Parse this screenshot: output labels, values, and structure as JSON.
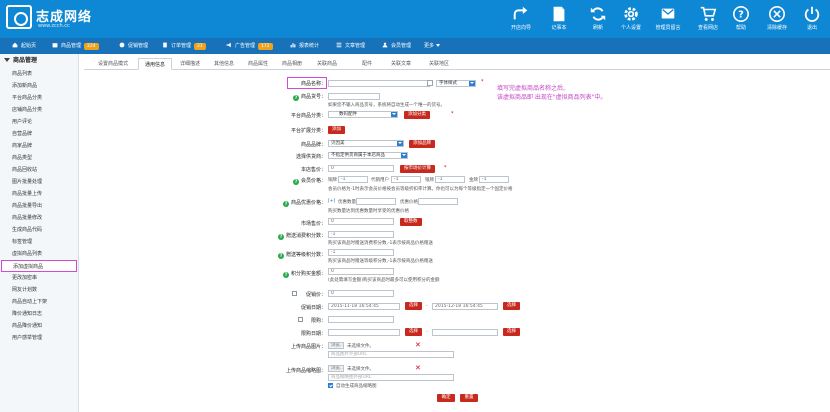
{
  "brand": {
    "name": "志成网络",
    "url": "www.zcch.cc"
  },
  "header_buttons": [
    {
      "label": "开店向导",
      "icon": "share-icon"
    },
    {
      "label": "记事本",
      "icon": "notepad-icon"
    },
    {
      "label": "刷新",
      "icon": "refresh-icon"
    },
    {
      "label": "个人设置",
      "icon": "gear-icon"
    },
    {
      "label": "管理员留言",
      "icon": "message-icon"
    },
    {
      "label": "查看网店",
      "icon": "cart-icon"
    },
    {
      "label": "帮助",
      "icon": "help-icon"
    },
    {
      "label": "清除缓存",
      "icon": "clear-icon"
    },
    {
      "label": "退出",
      "icon": "power-icon"
    }
  ],
  "nav": {
    "items": [
      {
        "label": "起始页",
        "badge": ""
      },
      {
        "label": "商品管理",
        "badge": "224"
      },
      {
        "label": "促销管理",
        "badge": ""
      },
      {
        "label": "订单管理",
        "badge": "21"
      },
      {
        "label": "广告管理",
        "badge": "172"
      },
      {
        "label": "报表统计",
        "badge": ""
      },
      {
        "label": "文章管理",
        "badge": ""
      },
      {
        "label": "会员管理",
        "badge": ""
      },
      {
        "label": "更多",
        "badge": ""
      }
    ]
  },
  "sidebar": {
    "title": "商品管理",
    "items": [
      {
        "label": "商品列表"
      },
      {
        "label": "添加新商品"
      },
      {
        "label": "平台商品分类"
      },
      {
        "label": "店铺商品分类"
      },
      {
        "label": "用户评论"
      },
      {
        "label": "自营品牌"
      },
      {
        "label": "商家品牌"
      },
      {
        "label": "商品类型"
      },
      {
        "label": "商品回收站"
      },
      {
        "label": "图片批量处理"
      },
      {
        "label": "商品批量上传"
      },
      {
        "label": "商品批量导出"
      },
      {
        "label": "商品批量修改"
      },
      {
        "label": "生成商品代码"
      },
      {
        "label": "标签管理"
      },
      {
        "label": "虚拟商品列表"
      },
      {
        "label": "添加虚拟商品"
      },
      {
        "label": "更改加密串"
      },
      {
        "label": "网友计划数"
      },
      {
        "label": "商品自动上下架"
      },
      {
        "label": "降价通知日志"
      },
      {
        "label": "商品降价通知"
      },
      {
        "label": "用户感举管理"
      }
    ]
  },
  "tabs": [
    "设置商品模式",
    "通用信息",
    "详细描述",
    "其他信息",
    "商品属性",
    "商品相册",
    "关联商品",
    "配件",
    "关联文章",
    "关联地区"
  ],
  "form": {
    "goods_name_label": "商品名称：",
    "font_style": "字体样式",
    "goods_sn_label": "商品货号：",
    "goods_sn_hint": "如果您不输入商品货号，系统将自动生成一个唯一的货号。",
    "category_label": "平台商品分类：",
    "category_value": "数码配件",
    "add_category": "添加分类",
    "ext_category_label": "平台扩展分类：",
    "add": "添加",
    "brand_label": "商品品牌：",
    "brand_value": "贝因美",
    "add_brand": "添加品牌",
    "supplier_label": "选择供货商：",
    "supplier_value": "不指定供货商属于本店商品",
    "shop_price_label": "本店售价：",
    "shop_price_value": "0",
    "calc_market_price": "按市场价计算",
    "member_price_label": "会员价格：",
    "member_levels": [
      {
        "name": "铜牌",
        "value": "-1"
      },
      {
        "name": "代销用户",
        "value": "-1"
      },
      {
        "name": "银牌",
        "value": "-1"
      },
      {
        "name": "金牌",
        "value": "-1"
      }
    ],
    "member_price_hint": "会员价格为-1时表示会员价格按会员等级折扣率计算。你也可以为每个等级指定一个固定价格",
    "volume_price_label": "商品优惠价格：",
    "volume_add": "[+]",
    "volume_qty_label": "优惠数量",
    "volume_price_label2": "优惠价格",
    "volume_hint": "购买数量达到优惠数量时享受的优惠价格",
    "market_price_label": "市场售价：",
    "market_price_value": "0",
    "round_price": "取整数",
    "give_points_label": "赠送消费积分数：",
    "give_points_value": "-1",
    "give_points_hint": "购买该商品时赠送消费积分数,-1表示按商品价格赠送",
    "rank_points_label": "赠送等级积分数：",
    "rank_points_value": "-1",
    "rank_points_hint": "购买该商品时赠送等级积分数,-1表示按商品价格赠送",
    "integral_label": "积分购买金额：",
    "integral_value": "0",
    "integral_hint": "(此处需填写金额)购买该商品时最多可以使用积分的金额",
    "promote_label": "促销价：",
    "promote_value": "0",
    "promote_date_label": "促销日期：",
    "promote_start": "2015-11-18 16:54:45",
    "promote_sep": "-",
    "promote_end": "2015-12-18 16:54:45",
    "choose": "选择",
    "limit_label": "限购：",
    "limit_date_label": "限购日期：",
    "upload_img_label": "上传商品图片：",
    "browse": "浏览...",
    "no_file": "未选择文件。",
    "img_url_placeholder": "商品图片外部URL",
    "upload_thumb_label": "上传商品缩略图：",
    "thumb_url_placeholder": "商品缩略图外部URL",
    "auto_thumb_label": "自动生成商品缩略图",
    "ok": "确定",
    "reset": "重置"
  },
  "annotation": {
    "line1": "填写完虚拟商品名称之后,",
    "line2": "该虚拟商品即 出现在\"虚拟商品列表\"中。"
  },
  "colors": {
    "header": "#0e87d4",
    "nav": "#1772b9",
    "button_red": "#c8291f",
    "highlight": "#d24cd1",
    "help_green": "#2aa84a"
  }
}
